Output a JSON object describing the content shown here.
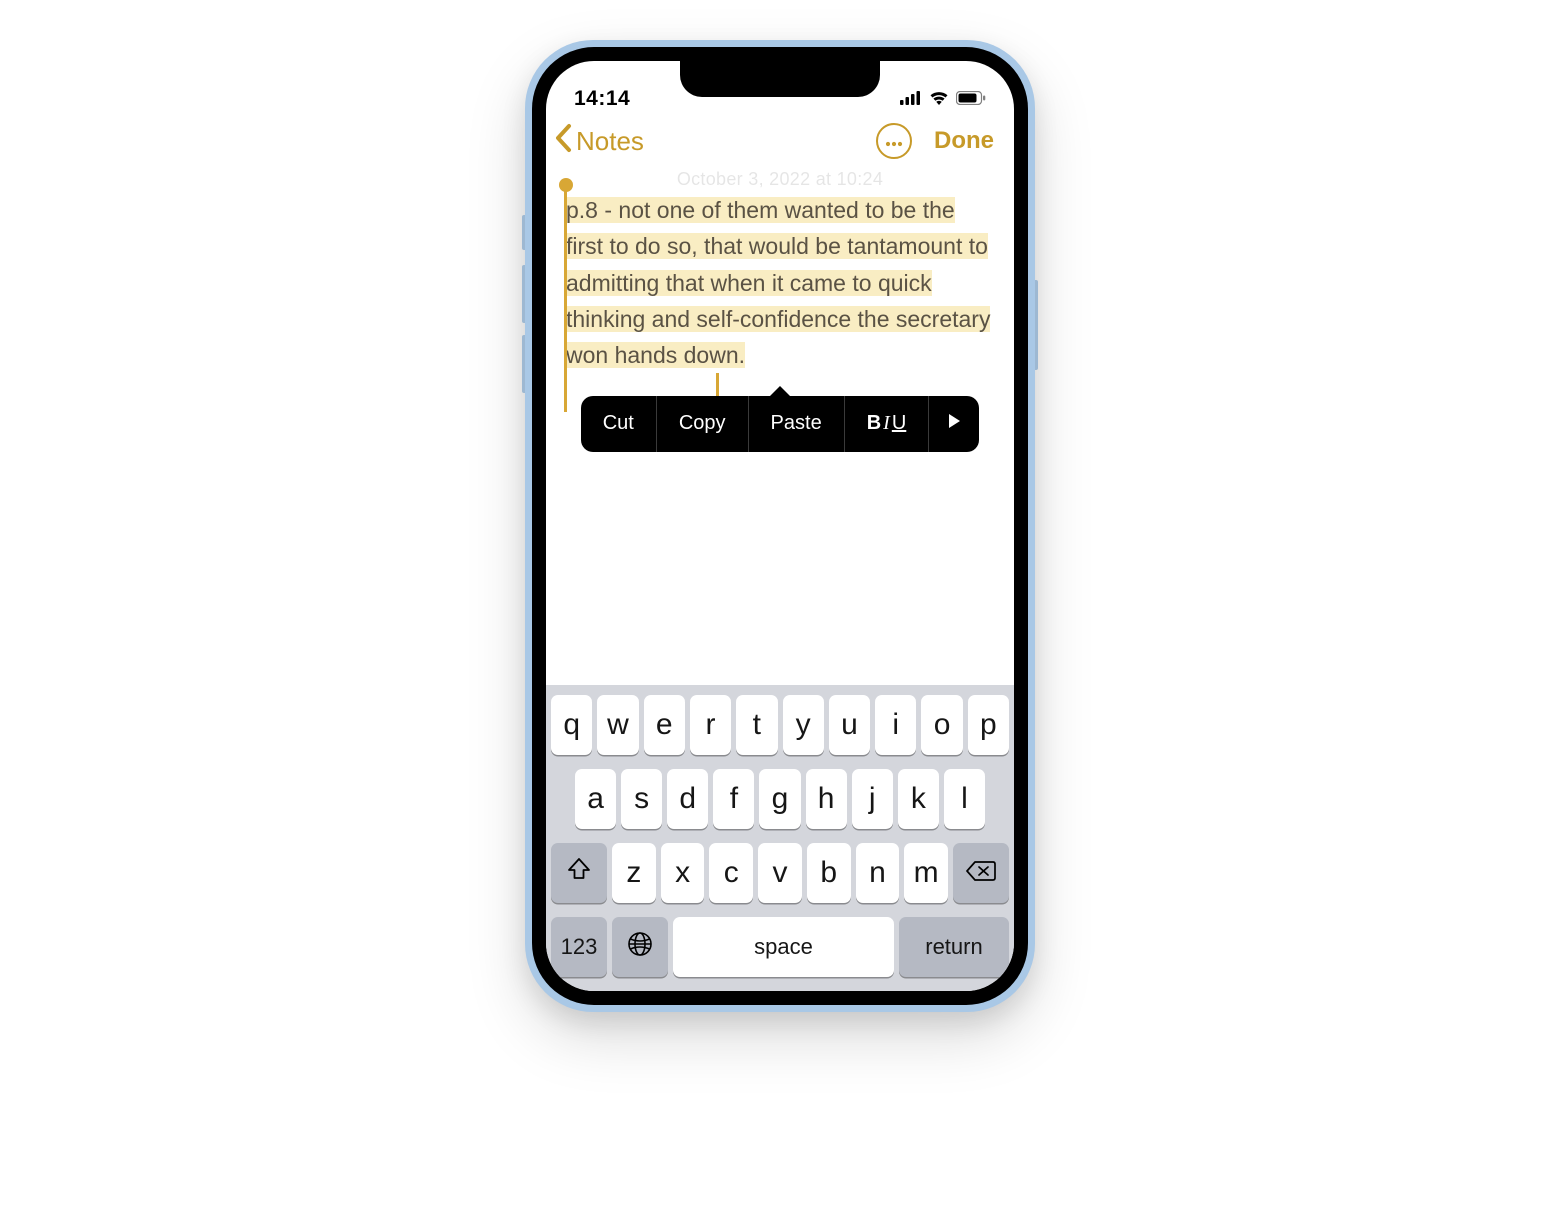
{
  "status": {
    "time": "14:14"
  },
  "nav": {
    "back_label": "Notes",
    "done_label": "Done"
  },
  "note": {
    "date_label": "October 3, 2022 at 10:24",
    "body": "p.8 - not one of them wanted to be the first to do so, that would be tantamount to admitting that when it came to quick thinking and self-confidence the secretary won hands down."
  },
  "context_menu": {
    "cut": "Cut",
    "copy": "Copy",
    "paste": "Paste",
    "format_b": "B",
    "format_i": "I",
    "format_u": "U",
    "more": "▶"
  },
  "keyboard": {
    "row1": [
      "q",
      "w",
      "e",
      "r",
      "t",
      "y",
      "u",
      "i",
      "o",
      "p"
    ],
    "row2": [
      "a",
      "s",
      "d",
      "f",
      "g",
      "h",
      "j",
      "k",
      "l"
    ],
    "row3": [
      "z",
      "x",
      "c",
      "v",
      "b",
      "n",
      "m"
    ],
    "numbers_label": "123",
    "space_label": "space",
    "return_label": "return"
  }
}
